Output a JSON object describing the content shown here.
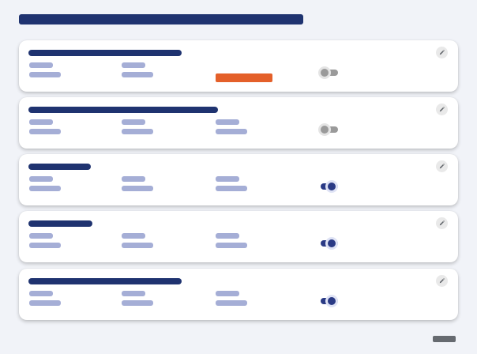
{
  "colors": {
    "background": "#f1f3f8",
    "card": "#ffffff",
    "title_bar": "#1f3370",
    "field_placeholder": "#a5aed6",
    "status_tag": "#e4602a",
    "toggle_on": "#2a3a85",
    "toggle_off": "#9a9a9a",
    "footer_button": "#666a70"
  },
  "icons": {
    "edit": "pencil-icon"
  },
  "cards": [
    {
      "fields": 2,
      "status_tag": true,
      "toggle": "off"
    },
    {
      "fields": 3,
      "status_tag": false,
      "toggle": "off"
    },
    {
      "fields": 3,
      "status_tag": false,
      "toggle": "on"
    },
    {
      "fields": 3,
      "status_tag": false,
      "toggle": "on"
    },
    {
      "fields": 3,
      "status_tag": false,
      "toggle": "on"
    }
  ]
}
